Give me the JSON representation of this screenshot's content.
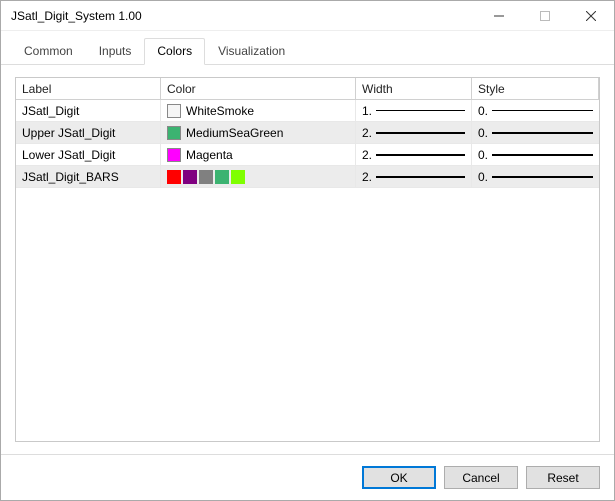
{
  "window": {
    "title": "JSatl_Digit_System 1.00"
  },
  "tabs": [
    {
      "label": "Common",
      "active": false
    },
    {
      "label": "Inputs",
      "active": false
    },
    {
      "label": "Colors",
      "active": true
    },
    {
      "label": "Visualization",
      "active": false
    }
  ],
  "headers": {
    "label": "Label",
    "color": "Color",
    "width": "Width",
    "style": "Style"
  },
  "rows": [
    {
      "label": "JSatl_Digit",
      "colorName": "WhiteSmoke",
      "swatch": "#f5f5f5",
      "width": "1.",
      "style": "0.",
      "line_w": 1,
      "shade": false
    },
    {
      "label": "Upper JSatl_Digit",
      "colorName": "MediumSeaGreen",
      "swatch": "#3cb371",
      "width": "2.",
      "style": "0.",
      "line_w": 2,
      "shade": true
    },
    {
      "label": "Lower JSatl_Digit",
      "colorName": "Magenta",
      "swatch": "#ff00ff",
      "width": "2.",
      "style": "0.",
      "line_w": 2,
      "shade": false
    },
    {
      "label": "JSatl_Digit_BARS",
      "colorName": "",
      "multi": [
        "#ff0000",
        "#800080",
        "#808080",
        "#3cb371",
        "#7fff00"
      ],
      "width": "2.",
      "style": "0.",
      "line_w": 2,
      "shade": true
    }
  ],
  "buttons": {
    "ok": "OK",
    "cancel": "Cancel",
    "reset": "Reset"
  }
}
